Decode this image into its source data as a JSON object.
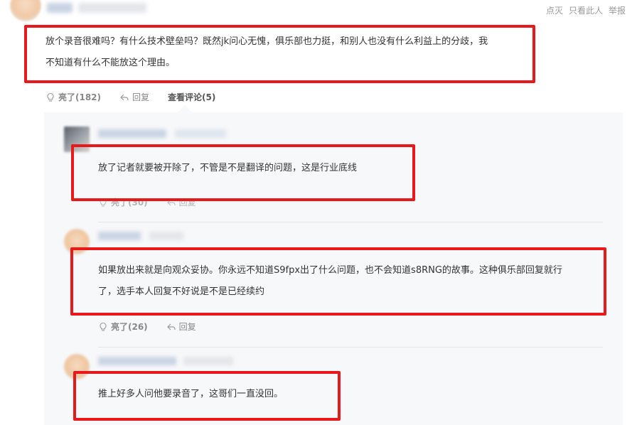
{
  "header": {
    "actions": [
      "点灭",
      "只看此人",
      "举报"
    ]
  },
  "main_comment": {
    "text_line1": "放个录音很难吗？有什么技术壁垒吗？既然jk问心无愧，俱乐部也力挺，和别人也没有什么利益上的分歧，我",
    "text_line2": "不知道有什么不能放这个理由。",
    "like_label": "亮了(182)",
    "reply_label": "回复",
    "view_replies_label": "查看评论(5)"
  },
  "replies": [
    {
      "text_line1": "放了记者就要被开除了，不管是不是翻译的问题，这是行业底线",
      "like_label": "亮了(30)",
      "reply_label": "回复"
    },
    {
      "text_line1": "如果放出来就是向观众妥协。你永远不知道S9fpx出了什么问题，也不会知道s8RNG的故事。这种俱乐部回复就行",
      "text_line2": "了，选手本人回复不好说是不是已经续约",
      "like_label": "亮了(26)",
      "reply_label": "回复"
    },
    {
      "text_line1": "推上好多人问他要录音了，这哥们一直没回。"
    }
  ],
  "colors": {
    "highlight": "#e8191b",
    "panel_bg": "#f7f8fa",
    "muted_text": "#888888"
  },
  "icons": [
    "lightbulb-icon",
    "reply-arrow-icon"
  ]
}
